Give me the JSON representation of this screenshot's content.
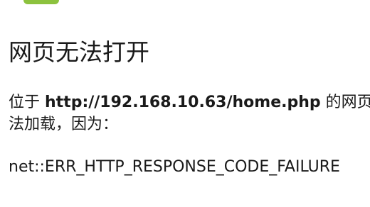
{
  "icon": {
    "name": "android-robot-icon",
    "color": "#8CC23E"
  },
  "title": "网页无法打开",
  "description": {
    "prefix": "位于 ",
    "url": "http://192.168.10.63/home.php",
    "suffix_line1": " 的网页无",
    "line2": "法加载，因为："
  },
  "error_code": "net::ERR_HTTP_RESPONSE_CODE_FAILURE"
}
